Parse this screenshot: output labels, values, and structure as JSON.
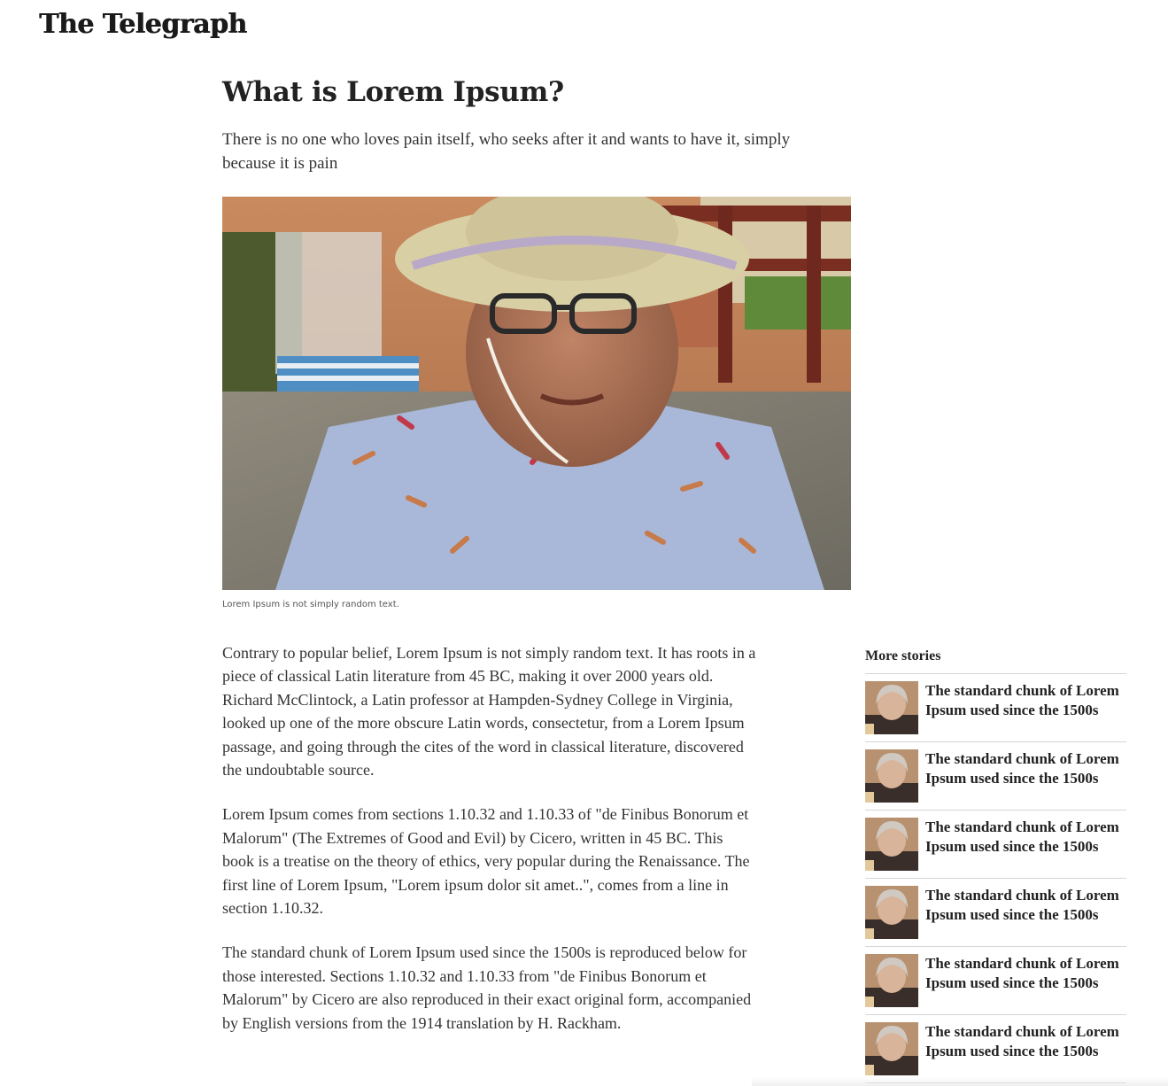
{
  "header": {
    "logo_text": "The Telegraph"
  },
  "article": {
    "headline": "What is Lorem Ipsum?",
    "standfirst": "There is no one who loves pain itself, who seeks after it and wants to have it, simply because it is pain",
    "image_caption": "Lorem Ipsum is not simply random text.",
    "paragraphs": [
      "Contrary to popular belief, Lorem Ipsum is not simply random text. It has roots in a piece of classical Latin literature from 45 BC, making it over 2000 years old. Richard McClintock, a Latin professor at Hampden-Sydney College in Virginia, looked up one of the more obscure Latin words, consectetur, from a Lorem Ipsum passage, and going through the cites of the word in classical literature, discovered the undoubtable source.",
      "Lorem Ipsum comes from sections 1.10.32 and 1.10.33 of \"de Finibus Bonorum et Malorum\" (The Extremes of Good and Evil) by Cicero, written in 45 BC. This book is a treatise on the theory of ethics, very popular during the Renaissance. The first line of Lorem Ipsum, \"Lorem ipsum dolor sit amet..\", comes from a line in section 1.10.32.",
      "The standard chunk of Lorem Ipsum used since the 1500s is reproduced below for those interested. Sections 1.10.32 and 1.10.33 from \"de Finibus Bonorum et Malorum\" by Cicero are also reproduced in their exact original form, accompanied by English versions from the 1914 translation by H. Rackham."
    ]
  },
  "sidebar": {
    "title": "More stories",
    "stories": [
      {
        "title": "The standard chunk of Lorem Ipsum used since the 1500s"
      },
      {
        "title": "The standard chunk of Lorem Ipsum used since the 1500s"
      },
      {
        "title": "The standard chunk of Lorem Ipsum used since the 1500s"
      },
      {
        "title": "The standard chunk of Lorem Ipsum used since the 1500s"
      },
      {
        "title": "The standard chunk of Lorem Ipsum used since the 1500s"
      },
      {
        "title": "The standard chunk of Lorem Ipsum used since the 1500s"
      }
    ]
  },
  "colors": {
    "text": "#222222",
    "body_text": "#333333",
    "divider": "#d6d6d6",
    "background": "#ffffff"
  }
}
